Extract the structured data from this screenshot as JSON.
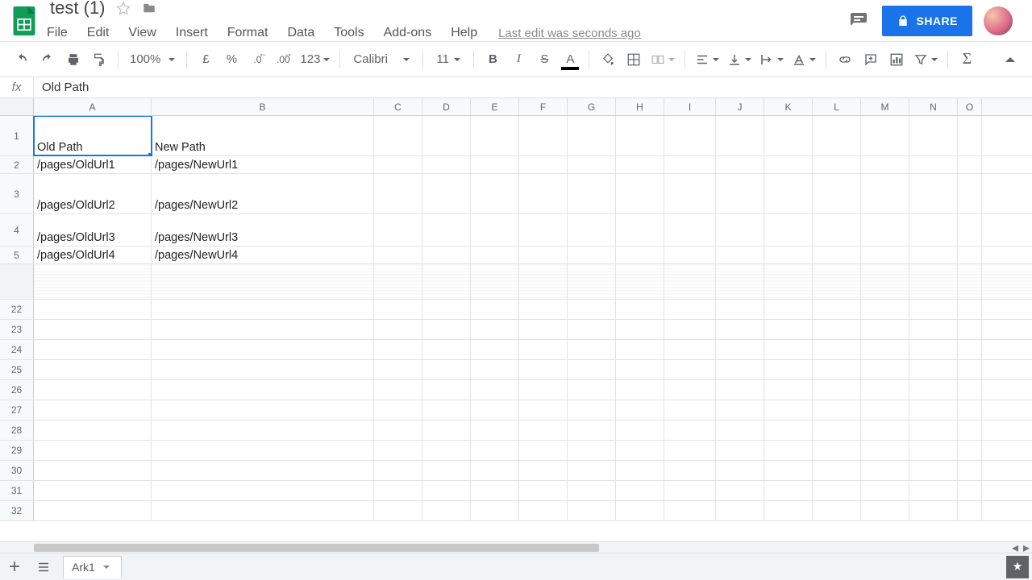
{
  "doc": {
    "name": "test (1)"
  },
  "menus": [
    "File",
    "Edit",
    "View",
    "Insert",
    "Format",
    "Data",
    "Tools",
    "Add-ons",
    "Help"
  ],
  "last_edit": "Last edit was seconds ago",
  "share_label": "SHARE",
  "toolbar": {
    "zoom": "100%",
    "currency": "£",
    "percent": "%",
    "dec_less": ".0",
    "dec_more": ".00",
    "more_formats": "123",
    "font": "Calibri",
    "font_size": "11"
  },
  "formula": {
    "fx": "fx",
    "value": "Old Path"
  },
  "columns": [
    "A",
    "B",
    "C",
    "D",
    "E",
    "F",
    "G",
    "H",
    "I",
    "J",
    "K",
    "L",
    "M",
    "N",
    "O"
  ],
  "col_widths": [
    "colA",
    "colB",
    "colOther",
    "colOther",
    "colOther",
    "colOther",
    "colOther",
    "colOther",
    "colI",
    "colOther",
    "colOther",
    "colOther",
    "colOther",
    "colOther",
    "colLast"
  ],
  "rows": [
    {
      "n": "1",
      "h": "big",
      "cells": [
        "Old Path",
        "New Path",
        "",
        "",
        "",
        "",
        "",
        "",
        "",
        "",
        "",
        "",
        "",
        "",
        ""
      ],
      "selected": 0
    },
    {
      "n": "2",
      "h": "small",
      "cells": [
        "/pages/OldUrl1",
        "/pages/NewUrl1",
        "",
        "",
        "",
        "",
        "",
        "",
        "",
        "",
        "",
        "",
        "",
        "",
        ""
      ]
    },
    {
      "n": "3",
      "h": "big",
      "cells": [
        "/pages/OldUrl2",
        "/pages/NewUrl2",
        "",
        "",
        "",
        "",
        "",
        "",
        "",
        "",
        "",
        "",
        "",
        "",
        ""
      ]
    },
    {
      "n": "4",
      "h": "med",
      "cells": [
        "/pages/OldUrl3",
        "/pages/NewUrl3",
        "",
        "",
        "",
        "",
        "",
        "",
        "",
        "",
        "",
        "",
        "",
        "",
        ""
      ]
    },
    {
      "n": "5",
      "h": "small",
      "cells": [
        "/pages/OldUrl4",
        "/pages/NewUrl4",
        "",
        "",
        "",
        "",
        "",
        "",
        "",
        "",
        "",
        "",
        "",
        "",
        ""
      ]
    }
  ],
  "tail_rows": [
    "22",
    "23",
    "24",
    "25",
    "26",
    "27",
    "28",
    "29",
    "30",
    "31",
    "32"
  ],
  "sheet_tab": "Ark1"
}
